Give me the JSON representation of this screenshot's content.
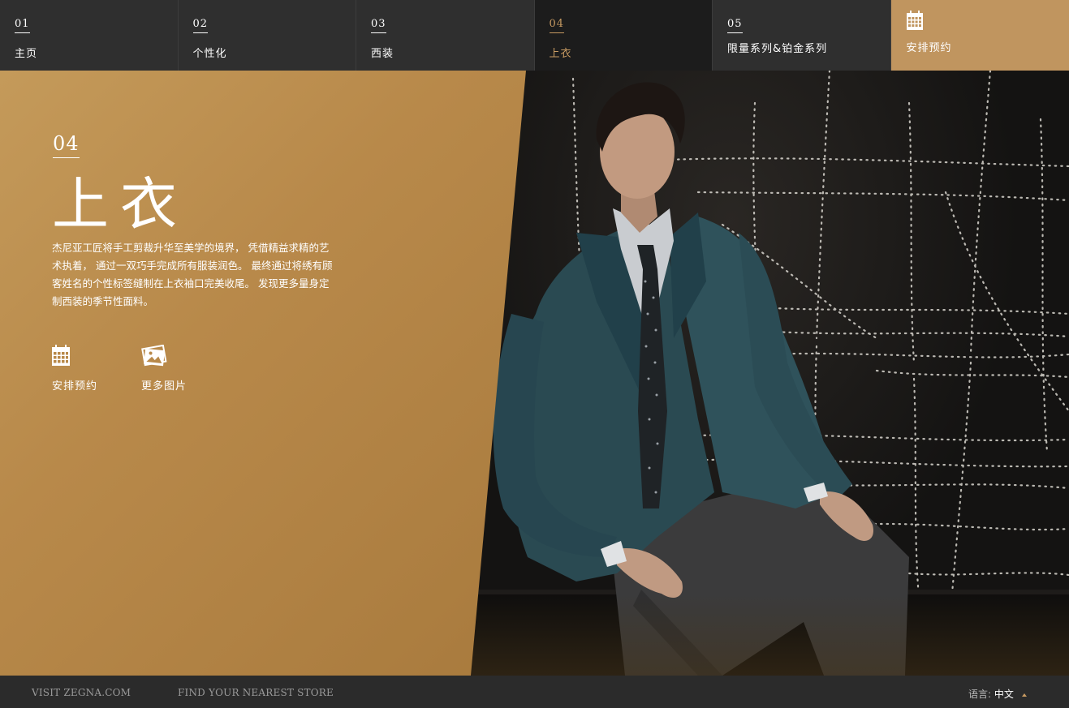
{
  "nav": {
    "items": [
      {
        "num": "01",
        "label": "主页"
      },
      {
        "num": "02",
        "label": "个性化"
      },
      {
        "num": "03",
        "label": "西装"
      },
      {
        "num": "04",
        "label": "上衣"
      },
      {
        "num": "05",
        "label": "限量系列&铂金系列"
      }
    ],
    "active_index": 3,
    "book_label": "安排预约",
    "book_icon": "calendar-icon"
  },
  "section": {
    "num": "04",
    "title": "上衣",
    "description": "杰尼亚工匠将手工剪裁升华至美学的境界， 凭借精益求精的艺术执着， 通过一双巧手完成所有服装润色。 最终通过将绣有顾客姓名的个性标签缝制在上衣袖口完美收尾。 发现更多量身定制西装的季节性面料。",
    "actions": [
      {
        "label": "安排预约",
        "icon": "calendar-icon"
      },
      {
        "label": "更多图片",
        "icon": "photos-icon"
      }
    ]
  },
  "footer": {
    "link1": "VISIT ZEGNA.COM",
    "link2": "FIND YOUR NEAREST STORE",
    "lang_label": "语言:",
    "lang_value": "中文"
  },
  "colors": {
    "accent": "#c89b62",
    "panel_gold": "#b8894a",
    "nav_bg": "#2f2f2f",
    "nav_active_bg": "#1c1c1c",
    "footer_bg": "#2b2b2b"
  }
}
